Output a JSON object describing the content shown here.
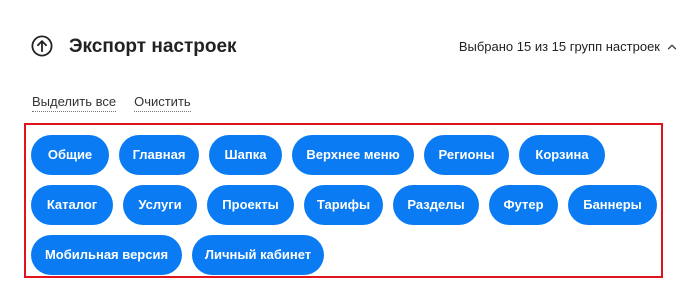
{
  "header": {
    "title": "Экспорт настроек",
    "selected_info": "Выбрано 15 из 15 групп настроек"
  },
  "actions": {
    "select_all": "Выделить все",
    "clear": "Очистить"
  },
  "groups": [
    {
      "label": "Общие",
      "selected": true
    },
    {
      "label": "Главная",
      "selected": true
    },
    {
      "label": "Шапка",
      "selected": true
    },
    {
      "label": "Верхнее меню",
      "selected": true
    },
    {
      "label": "Регионы",
      "selected": true
    },
    {
      "label": "Корзина",
      "selected": true
    },
    {
      "label": "Каталог",
      "selected": true
    },
    {
      "label": "Услуги",
      "selected": true
    },
    {
      "label": "Проекты",
      "selected": true
    },
    {
      "label": "Тарифы",
      "selected": true
    },
    {
      "label": "Разделы",
      "selected": true
    },
    {
      "label": "Футер",
      "selected": true
    },
    {
      "label": "Баннеры",
      "selected": true
    },
    {
      "label": "Мобильная версия",
      "selected": true
    },
    {
      "label": "Личный кабинет",
      "selected": true
    }
  ],
  "icons": {
    "export": "arrow-up-circle-icon",
    "expand": "chevron-up-icon"
  },
  "colors": {
    "chip_background": "#0a7bf2",
    "chip_text": "#ffffff",
    "highlight_border": "#e0141f"
  }
}
